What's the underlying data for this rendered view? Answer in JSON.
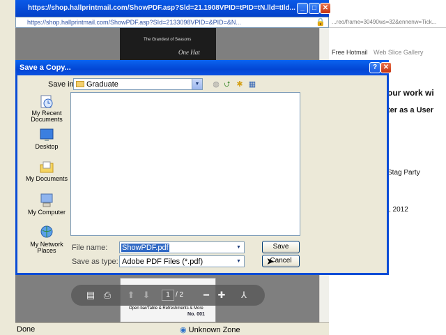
{
  "browser": {
    "title": "https://shop.hallprintmail.com/ShowPDF.asp?Sld=21.1908VPID=tPID=tN.lld=tIld...",
    "address": "https://shop.hallprintmail.com/ShowPDF.asp?SId=2133098VPID=&PID=&N...",
    "pdf_heading": "The Grandest of Seasons",
    "pdf_signature": "One Hat",
    "pdf_footer_line": "Open bar/Table & Refreshments & More",
    "pdf_footer_no": "No. 001",
    "page_current": "1",
    "page_total": "/ 2",
    "status_left": "Done",
    "status_zone": "Unknown Zone"
  },
  "right_page": {
    "address_fragment": "...reo/frame=30490ws=32&ennenw=Tick...",
    "link_hotmail": "Free Hotmail",
    "link_gallery": "Web Slice Gallery",
    "text_work": "our work wi",
    "text_user": "ter as a User",
    "text_party": "Stag Party",
    "text_date": ", 2012"
  },
  "dialog": {
    "title": "Save a Copy...",
    "help_glyph": "?",
    "close_glyph": "✕",
    "save_in_label": "Save in:",
    "save_in_value": "Graduate",
    "places": [
      {
        "label": "My Recent Documents"
      },
      {
        "label": "Desktop"
      },
      {
        "label": "My Documents"
      },
      {
        "label": "My Computer"
      },
      {
        "label": "My Network Places"
      }
    ],
    "file_name_label": "File name:",
    "file_name_value": "ShowPDF.pdf",
    "save_as_type_label": "Save as type:",
    "save_as_type_value": "Adobe PDF Files (*.pdf)",
    "save_button": "Save",
    "cancel_button": "Cancel"
  },
  "colors": {
    "xp_title_blue": "#0346d4",
    "dialog_face": "#ece9d8",
    "selection_blue": "#316ac5"
  }
}
